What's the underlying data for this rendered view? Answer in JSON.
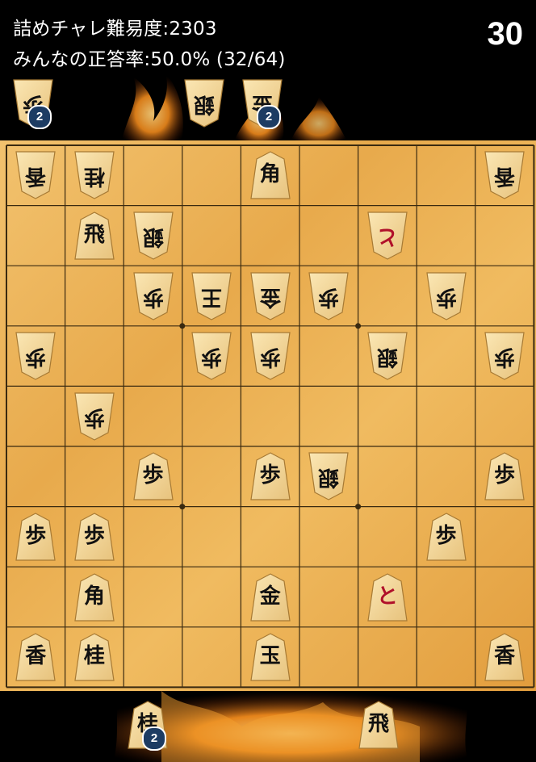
{
  "header": {
    "difficulty": "詰めチャレ難易度:2303",
    "accuracy": "みんなの正答率:50.0% (32/64)",
    "timer": "30"
  },
  "board": {
    "rows": [
      [
        {
          "c": "香",
          "side": "gote"
        },
        {
          "c": "桂",
          "side": "gote"
        },
        null,
        null,
        {
          "c": "角",
          "side": "sente"
        },
        null,
        null,
        null,
        {
          "c": "香",
          "side": "gote"
        }
      ],
      [
        null,
        {
          "c": "飛",
          "side": "sente"
        },
        {
          "c": "銀",
          "side": "gote"
        },
        null,
        null,
        null,
        {
          "c": "と",
          "side": "gote",
          "promoted": true
        },
        null,
        null
      ],
      [
        null,
        null,
        {
          "c": "歩",
          "side": "gote"
        },
        {
          "c": "王",
          "side": "gote"
        },
        {
          "c": "金",
          "side": "gote"
        },
        {
          "c": "歩",
          "side": "gote"
        },
        null,
        {
          "c": "歩",
          "side": "gote"
        },
        null
      ],
      [
        {
          "c": "歩",
          "side": "gote"
        },
        null,
        null,
        {
          "c": "歩",
          "side": "gote"
        },
        {
          "c": "歩",
          "side": "gote"
        },
        null,
        {
          "c": "銀",
          "side": "gote"
        },
        null,
        {
          "c": "歩",
          "side": "gote"
        }
      ],
      [
        null,
        {
          "c": "歩",
          "side": "gote"
        },
        null,
        null,
        null,
        null,
        null,
        null,
        null
      ],
      [
        null,
        null,
        {
          "c": "歩",
          "side": "sente"
        },
        null,
        {
          "c": "歩",
          "side": "sente"
        },
        {
          "c": "銀",
          "side": "gote"
        },
        null,
        null,
        {
          "c": "歩",
          "side": "sente"
        }
      ],
      [
        {
          "c": "歩",
          "side": "sente"
        },
        {
          "c": "歩",
          "side": "sente"
        },
        null,
        null,
        null,
        null,
        null,
        {
          "c": "歩",
          "side": "sente"
        },
        null
      ],
      [
        null,
        {
          "c": "角",
          "side": "sente"
        },
        null,
        null,
        {
          "c": "金",
          "side": "sente"
        },
        null,
        {
          "c": "と",
          "side": "sente",
          "promoted": true
        },
        null,
        null
      ],
      [
        {
          "c": "香",
          "side": "sente"
        },
        {
          "c": "桂",
          "side": "sente"
        },
        null,
        null,
        {
          "c": "玉",
          "side": "sente"
        },
        null,
        null,
        null,
        {
          "c": "香",
          "side": "sente"
        }
      ]
    ]
  },
  "gote_hand": [
    {
      "c": "歩",
      "count": "2"
    },
    {
      "c": "銀",
      "count": ""
    },
    {
      "c": "金",
      "count": "2"
    }
  ],
  "sente_hand": [
    {
      "c": "桂",
      "count": "2"
    },
    {
      "c": "飛",
      "count": ""
    }
  ],
  "colors": {
    "board": "#eab056",
    "line": "#3a2a10",
    "badge": "#1d3c63",
    "promoted_text": "#b0102a"
  }
}
